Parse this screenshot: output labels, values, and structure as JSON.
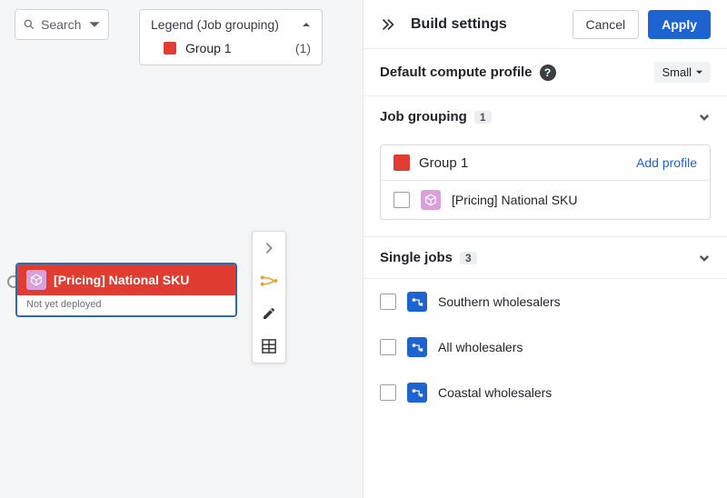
{
  "canvas": {
    "search_label": "Search",
    "legend": {
      "title": "Legend (Job grouping)",
      "group_label": "Group 1",
      "group_count": "(1)"
    },
    "node": {
      "title": "[Pricing] National SKU",
      "status": "Not yet deployed"
    }
  },
  "panel": {
    "title": "Build settings",
    "cancel_label": "Cancel",
    "apply_label": "Apply",
    "compute_profile": {
      "label": "Default compute profile",
      "value": "Small"
    },
    "job_grouping": {
      "label": "Job grouping",
      "count": "1",
      "group_name": "Group 1",
      "add_profile_label": "Add profile",
      "item_label": "[Pricing] National SKU"
    },
    "single_jobs": {
      "label": "Single jobs",
      "count": "3",
      "items": [
        "Southern wholesalers",
        "All wholesalers",
        "Coastal wholesalers"
      ]
    }
  }
}
